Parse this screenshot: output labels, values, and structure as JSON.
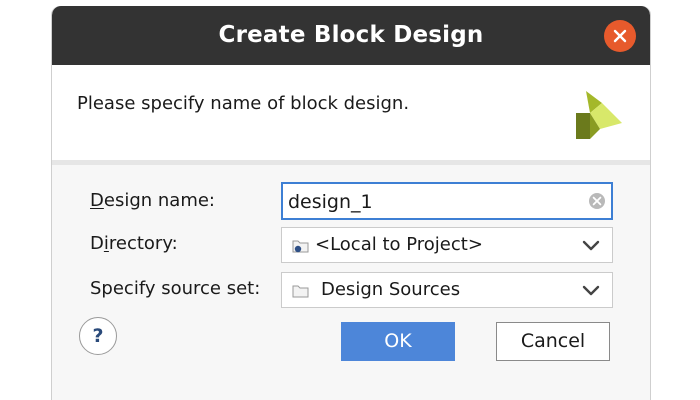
{
  "dialog": {
    "title": "Create Block Design",
    "message": "Please specify name of block design.",
    "logo_icon": "vivado-logo-icon",
    "close_icon": "close-icon"
  },
  "form": {
    "design_name": {
      "label_accel": "D",
      "label_rest": "esign name:",
      "value": "design_1"
    },
    "directory": {
      "label_before": "D",
      "label_accel": "i",
      "label_rest": "rectory:",
      "value": "<Local to Project>",
      "icon": "local-folder-icon"
    },
    "source_set": {
      "label": "Specify source set:",
      "value": "Design Sources",
      "icon": "folder-icon"
    }
  },
  "buttons": {
    "help": "?",
    "ok": "OK",
    "cancel": "Cancel"
  },
  "colors": {
    "titlebar": "#333333",
    "close": "#e75a2c",
    "accent": "#4d86d9",
    "logo_dark": "#6b7a1c",
    "logo_mid": "#a4b82a",
    "logo_light": "#d8e86a"
  }
}
